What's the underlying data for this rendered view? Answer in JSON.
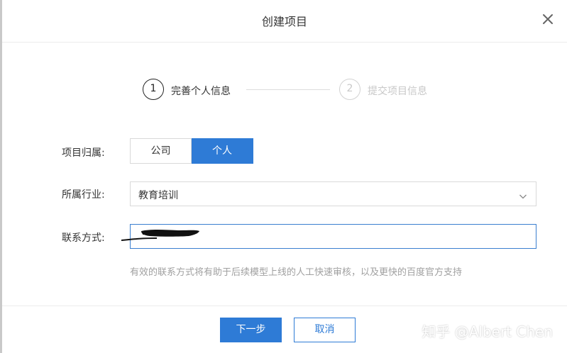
{
  "dialog": {
    "title": "创建项目",
    "close_icon": "close-icon"
  },
  "steps": [
    {
      "number": "1",
      "label": "完善个人信息",
      "state": "active"
    },
    {
      "number": "2",
      "label": "提交项目信息",
      "state": "pending"
    }
  ],
  "form": {
    "ownership": {
      "label": "项目归属:",
      "options": [
        "公司",
        "个人"
      ],
      "selected": "个人"
    },
    "industry": {
      "label": "所属行业:",
      "value": "教育培训",
      "arrow_icon": "chevron-down-icon"
    },
    "contact": {
      "label": "联系方式:",
      "hint": "有效的联系方式将有助于后续模型上线的人工快速审核，以及更快的百度官方支持"
    }
  },
  "footer": {
    "next_label": "下一步",
    "cancel_label": "取消"
  },
  "watermark": "知乎 @Albert Chen",
  "colors": {
    "accent": "#2e7bd6",
    "hint": "#a0a0a0",
    "pending": "#c8c8c8"
  }
}
